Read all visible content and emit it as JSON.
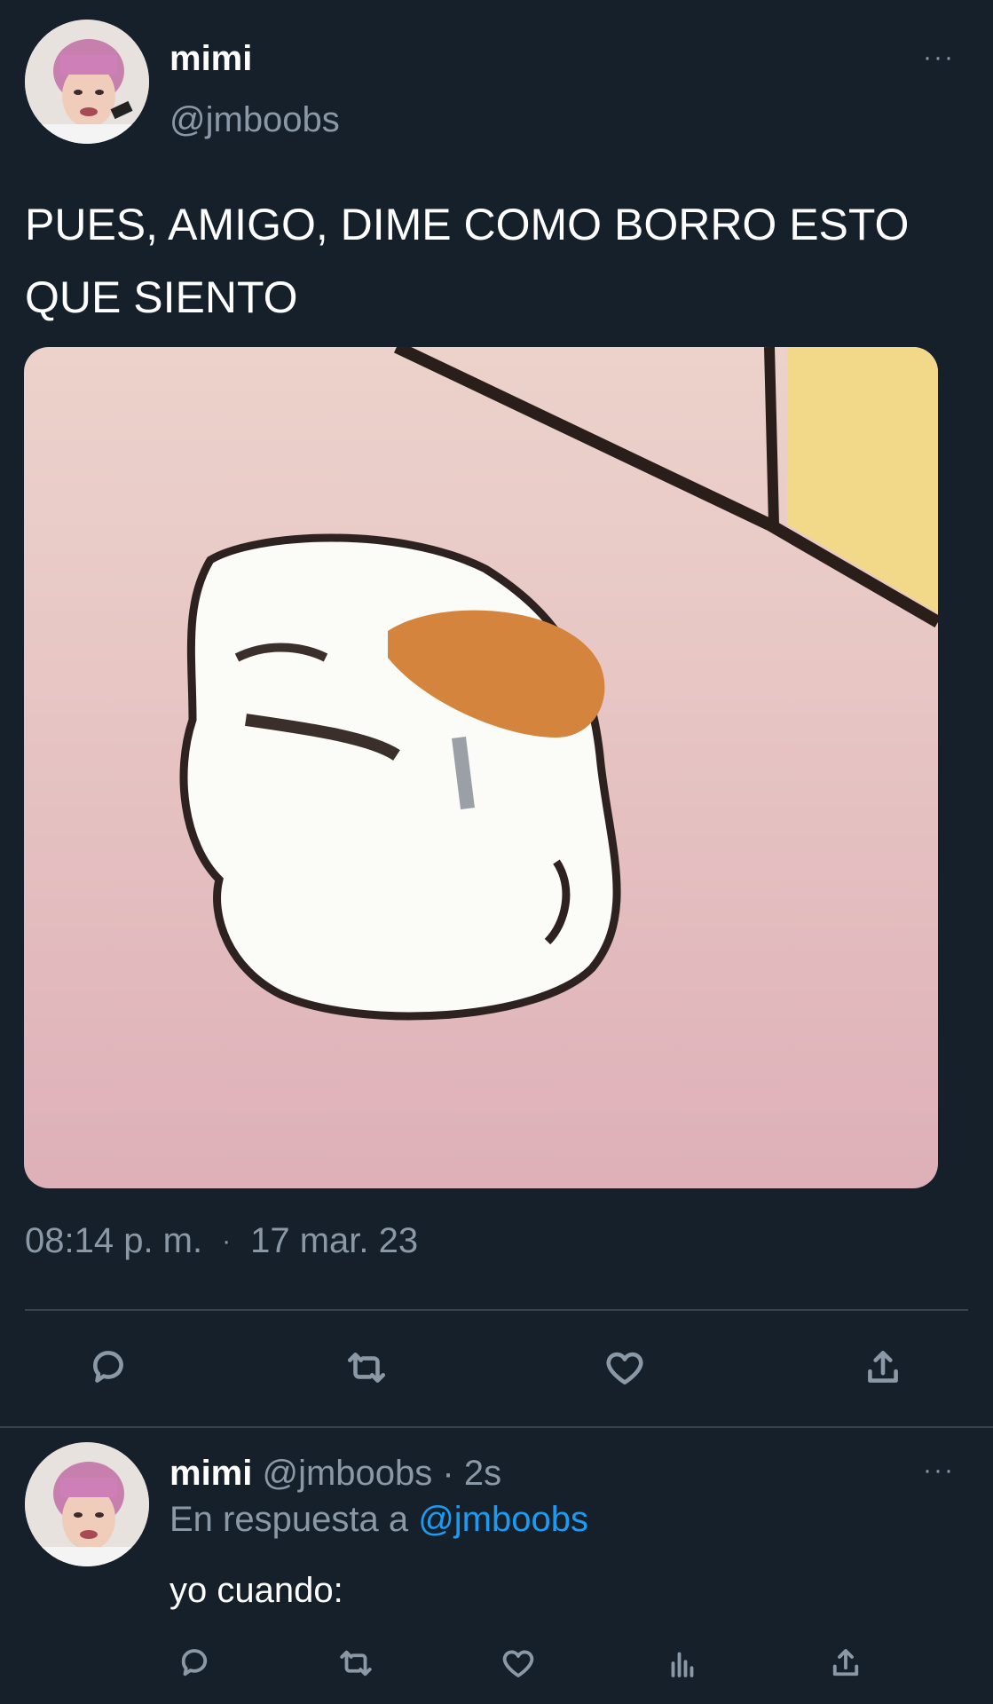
{
  "tweet": {
    "author": {
      "name": "mimi",
      "handle": "@jmboobs"
    },
    "text_line1": "PUES, AMIGO, DIME COMO BORRO ESTO",
    "text_line2": "QUE SIENTO",
    "time": "08:14 p. m.",
    "separator": "·",
    "date": "17 mar. 23",
    "more_label": "···",
    "actions": [
      "reply-icon",
      "retweet-icon",
      "like-icon",
      "share-icon"
    ]
  },
  "reply": {
    "author": {
      "name": "mimi",
      "handle": "@jmboobs",
      "time": "· 2s"
    },
    "replying_to_label": "En respuesta a",
    "replying_to_handle": "@jmboobs",
    "text": "yo cuando:",
    "more_label": "···",
    "actions": [
      "reply-icon",
      "retweet-icon",
      "like-icon",
      "analytics-icon",
      "share-icon"
    ]
  },
  "colors": {
    "background": "#15202b",
    "text": "#ffffff",
    "muted": "#8b98a5",
    "accent": "#1d9bf0",
    "divider": "#38444d"
  }
}
